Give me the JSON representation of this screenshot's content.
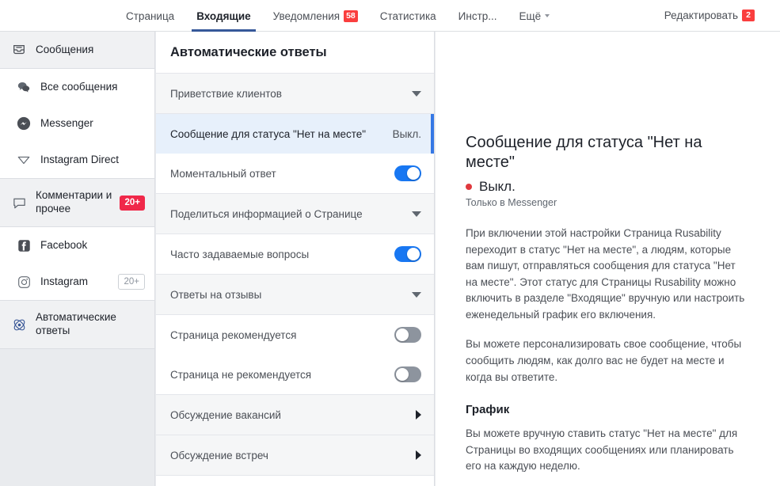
{
  "topnav": {
    "items": [
      {
        "label": "Страница",
        "state": "normal",
        "badge": null,
        "caret": false
      },
      {
        "label": "Входящие",
        "state": "active",
        "badge": null,
        "caret": false
      },
      {
        "label": "Уведомления",
        "state": "normal",
        "badge": "58",
        "caret": false
      },
      {
        "label": "Статистика",
        "state": "normal",
        "badge": null,
        "caret": false
      },
      {
        "label": "Инстр...",
        "state": "normal",
        "badge": null,
        "caret": false
      },
      {
        "label": "Ещё",
        "state": "normal",
        "badge": null,
        "caret": true
      }
    ],
    "edit": {
      "label": "Редактировать",
      "badge": "2"
    }
  },
  "sidebar": {
    "items": [
      {
        "label": "Сообщения",
        "icon": "inbox-icon",
        "badge": null,
        "badge_style": null,
        "shaded": true,
        "sub": false
      },
      {
        "label": "Все сообщения",
        "icon": "messages-bubbles-icon",
        "badge": null,
        "badge_style": null,
        "shaded": false,
        "sub": true
      },
      {
        "label": "Messenger",
        "icon": "messenger-icon",
        "badge": null,
        "badge_style": null,
        "shaded": false,
        "sub": true
      },
      {
        "label": "Instagram Direct",
        "icon": "instagram-direct-icon",
        "badge": null,
        "badge_style": null,
        "shaded": false,
        "sub": true
      },
      {
        "label": "Комментарии и прочее",
        "icon": "comment-bubble-icon",
        "badge": "20+",
        "badge_style": "filled",
        "shaded": true,
        "sub": false
      },
      {
        "label": "Facebook",
        "icon": "facebook-icon",
        "badge": null,
        "badge_style": null,
        "shaded": false,
        "sub": true
      },
      {
        "label": "Instagram",
        "icon": "instagram-icon",
        "badge": "20+",
        "badge_style": "outline",
        "shaded": false,
        "sub": true
      },
      {
        "label": "Автоматические ответы",
        "icon": "automation-atom-icon",
        "badge": null,
        "badge_style": null,
        "shaded": true,
        "sub": false
      }
    ]
  },
  "midpanel": {
    "header": "Автоматические ответы",
    "rows": [
      {
        "label": "Приветствие клиентов",
        "type": "section",
        "control": "caret-down",
        "status": null
      },
      {
        "label": "Сообщение для статуса \"Нет на месте\"",
        "type": "selected",
        "control": "status-text",
        "status": "Выкл."
      },
      {
        "label": "Моментальный ответ",
        "type": "normal",
        "control": "toggle-on",
        "status": null
      },
      {
        "label": "Поделиться информацией о Странице",
        "type": "section",
        "control": "caret-down",
        "status": null
      },
      {
        "label": "Часто задаваемые вопросы",
        "type": "normal",
        "control": "toggle-on",
        "status": null
      },
      {
        "label": "Ответы на отзывы",
        "type": "section",
        "control": "caret-down",
        "status": null
      },
      {
        "label": "Страница рекомендуется",
        "type": "normal",
        "control": "toggle-off",
        "status": null
      },
      {
        "label": "Страница не рекомендуется",
        "type": "normal",
        "control": "toggle-off",
        "status": null
      },
      {
        "label": "Обсуждение вакансий",
        "type": "section",
        "control": "caret-right",
        "status": null
      },
      {
        "label": "Обсуждение встреч",
        "type": "section",
        "control": "caret-right",
        "status": null
      }
    ]
  },
  "rightpanel": {
    "title": "Сообщение для статуса \"Нет на месте\"",
    "status": "Выкл.",
    "subtitle": "Только в Messenger",
    "paragraph1": "При включении этой настройки Страница Rusability переходит в статус \"Нет на месте\", а людям, которые вам пишут, отправляться сообщения для статуса \"Нет на месте\". Этот статус для Страницы Rusability можно включить в разделе \"Входящие\" вручную или настроить еженедельный график его включения.",
    "paragraph2": "Вы можете персонализировать свое сообщение, чтобы сообщить людям, как долго вас не будет на месте и когда вы ответите.",
    "section_heading": "График",
    "paragraph3": "Вы можете вручную ставить статус \"Нет на месте\" для Страницы во входящих сообщениях или планировать его на каждую неделю."
  },
  "colors": {
    "accent_blue": "#1877f2",
    "active_tab_underline": "#365899",
    "badge_red": "#fa3e3e",
    "status_dot_red": "#e0393e",
    "selected_row_bg": "#e7f0fb",
    "selected_row_border": "#3578e5",
    "page_bg": "#e9ebee"
  }
}
